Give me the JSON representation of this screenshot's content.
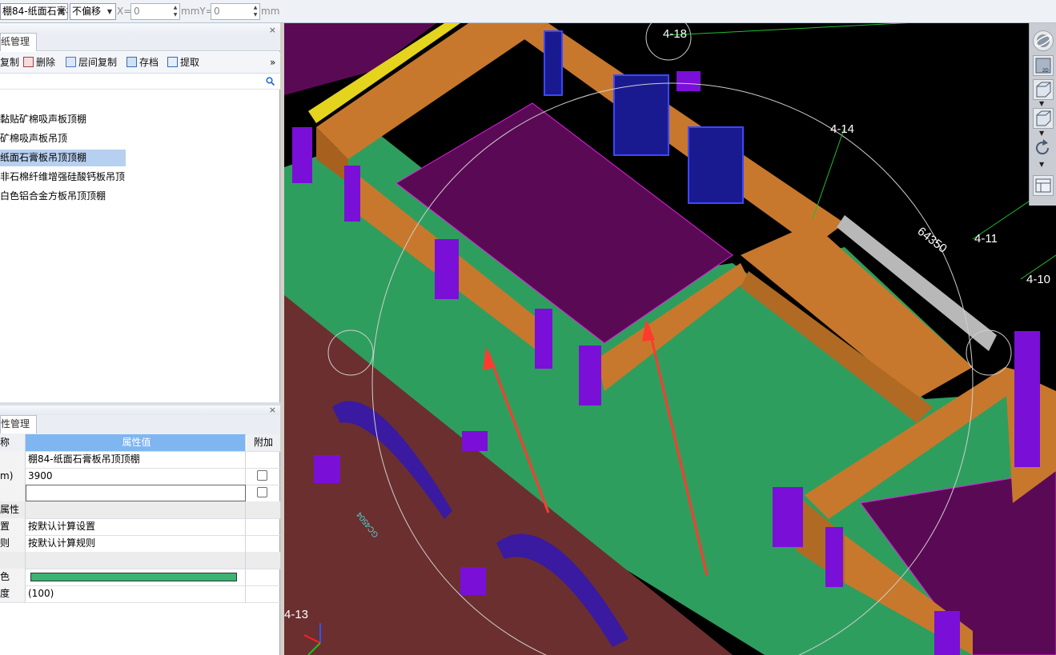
{
  "toolbar": {
    "component_select": "棚84-纸面石膏板",
    "offset_select": "不偏移",
    "x_label": "X=",
    "x_value": "0",
    "x_unit": "mm",
    "y_label": "mmY=",
    "y_value": "0",
    "y_unit": "mm"
  },
  "list_panel": {
    "tab": "纸管理",
    "close": "×",
    "buttons": [
      {
        "label": "复制",
        "icon": "copy-icon"
      },
      {
        "label": "删除",
        "icon": "delete-icon"
      },
      {
        "label": "层间复制",
        "icon": "floor-copy-icon"
      },
      {
        "label": "存档",
        "icon": "archive-icon"
      },
      {
        "label": "提取",
        "icon": "extract-icon"
      }
    ],
    "more": "»",
    "items": [
      {
        "label": "黏贴矿棉吸声板顶棚",
        "selected": false
      },
      {
        "label": "矿棉吸声板吊顶",
        "selected": false
      },
      {
        "label": "纸面石膏板吊顶顶棚",
        "selected": true
      },
      {
        "label": "非石棉纤维增强硅酸钙板吊顶",
        "selected": false
      },
      {
        "label": "白色铝合金方板吊顶顶棚",
        "selected": false
      }
    ]
  },
  "prop_panel": {
    "tab": "性管理",
    "close": "×",
    "headers": {
      "name": "称",
      "value": "属性值",
      "extra": "附加"
    },
    "rows": [
      {
        "name": "",
        "value": "棚84-纸面石膏板吊顶顶棚",
        "checkbox": false
      },
      {
        "name": "m)",
        "value": "3900",
        "checkbox": true
      },
      {
        "name": "",
        "value": "",
        "checkbox": true,
        "editing": true
      },
      {
        "name": "属性",
        "value": "",
        "checkbox": false,
        "group": true
      },
      {
        "name": "置",
        "value": "按默认计算设置",
        "checkbox": false
      },
      {
        "name": "则",
        "value": "按默认计算规则",
        "checkbox": false
      },
      {
        "name": "",
        "value": "",
        "checkbox": false,
        "group": true
      },
      {
        "name": "色",
        "value": "",
        "checkbox": false,
        "color": "#3cb371"
      },
      {
        "name": "度",
        "value": "(100)",
        "checkbox": false
      }
    ]
  },
  "viewport": {
    "axis_labels": [
      "4-18",
      "4-14",
      "4-11",
      "4-10",
      "4-13"
    ],
    "dimension": "64350",
    "rotated_text": "GC4504"
  },
  "colors": {
    "floor_green": "#2e9e5e",
    "beam_orange": "#c8782c",
    "column_purple": "#7a0fd8",
    "slab_purple": "#5a0a55",
    "wall_brown": "#6b2f30",
    "arrow_red": "#ff3b2f",
    "selection_blue": "#b8d0f0"
  },
  "right_toolbar": [
    "orbit-icon",
    "view-2d-icon",
    "box-view-icon",
    "box-view-2-icon",
    "rotate-icon",
    "layout-icon"
  ]
}
